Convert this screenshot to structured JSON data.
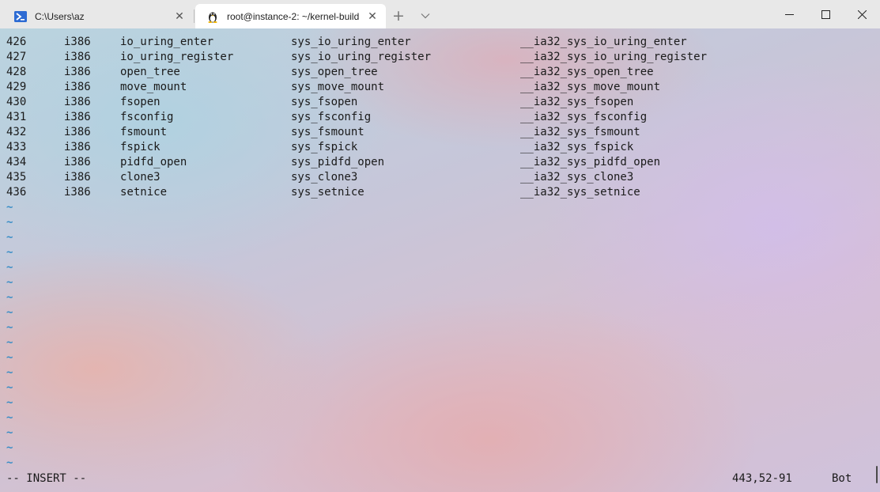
{
  "tabs": [
    {
      "label": "C:\\Users\\az",
      "icon": "powershell-icon",
      "active": false
    },
    {
      "label": "root@instance-2: ~/kernel-build",
      "icon": "linux-tux-icon",
      "active": true
    }
  ],
  "titlebar": {
    "new_tab": "+",
    "dropdown": "⌵",
    "minimize": "—",
    "maximize": "☐",
    "close": "✕"
  },
  "table": {
    "rows": [
      {
        "num": "426",
        "abi": "i386",
        "name": "io_uring_enter",
        "entry": "sys_io_uring_enter",
        "compat": "__ia32_sys_io_uring_enter"
      },
      {
        "num": "427",
        "abi": "i386",
        "name": "io_uring_register",
        "entry": "sys_io_uring_register",
        "compat": "__ia32_sys_io_uring_register"
      },
      {
        "num": "428",
        "abi": "i386",
        "name": "open_tree",
        "entry": "sys_open_tree",
        "compat": "__ia32_sys_open_tree"
      },
      {
        "num": "429",
        "abi": "i386",
        "name": "move_mount",
        "entry": "sys_move_mount",
        "compat": "__ia32_sys_move_mount"
      },
      {
        "num": "430",
        "abi": "i386",
        "name": "fsopen",
        "entry": "sys_fsopen",
        "compat": "__ia32_sys_fsopen"
      },
      {
        "num": "431",
        "abi": "i386",
        "name": "fsconfig",
        "entry": "sys_fsconfig",
        "compat": "__ia32_sys_fsconfig"
      },
      {
        "num": "432",
        "abi": "i386",
        "name": "fsmount",
        "entry": "sys_fsmount",
        "compat": "__ia32_sys_fsmount"
      },
      {
        "num": "433",
        "abi": "i386",
        "name": "fspick",
        "entry": "sys_fspick",
        "compat": "__ia32_sys_fspick"
      },
      {
        "num": "434",
        "abi": "i386",
        "name": "pidfd_open",
        "entry": "sys_pidfd_open",
        "compat": "__ia32_sys_pidfd_open"
      },
      {
        "num": "435",
        "abi": "i386",
        "name": "clone3",
        "entry": "sys_clone3",
        "compat": "__ia32_sys_clone3"
      },
      {
        "num": "436",
        "abi": "i386",
        "name": "setnice",
        "entry": "sys_setnice",
        "compat": "__ia32_sys_setnice"
      }
    ]
  },
  "empty_lines": [
    "~",
    "~",
    "~",
    "~",
    "~",
    "~",
    "~",
    "~",
    "~",
    "~",
    "~",
    "~",
    "~",
    "~",
    "~",
    "~",
    "~",
    "~"
  ],
  "status": {
    "mode": "-- INSERT --",
    "cursor": "443,52-91",
    "scroll": "Bot"
  },
  "colors": {
    "tilde": "#3a8ec7",
    "text": "#1a1a1a"
  }
}
